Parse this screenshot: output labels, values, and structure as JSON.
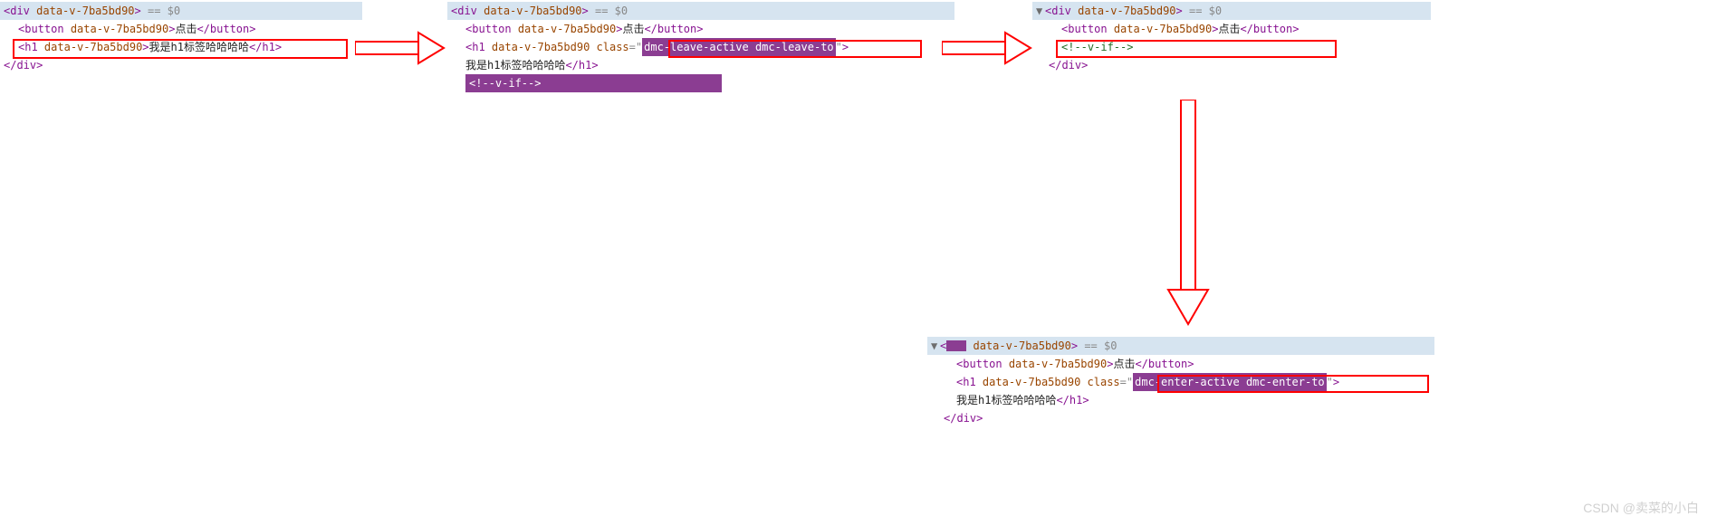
{
  "common": {
    "attr": "data-v-7ba5bd90",
    "dollar": "== $0",
    "button_text": "点击",
    "h1_text": "我是h1标签哈哈哈哈",
    "vif_comment": "<!--v-if-->",
    "close_div": "</div>",
    "close_h1": "</h1>",
    "close_button": "</button>",
    "div_tag": "div",
    "button_tag": "button",
    "h1_tag": "h1",
    "class_attr": "class"
  },
  "panel2": {
    "h1_class_value": "dmc-leave-active dmc-leave-to"
  },
  "panel4": {
    "h1_class_value": "dmc-enter-active dmc-enter-to"
  },
  "watermark": "CSDN @卖菜的小白"
}
